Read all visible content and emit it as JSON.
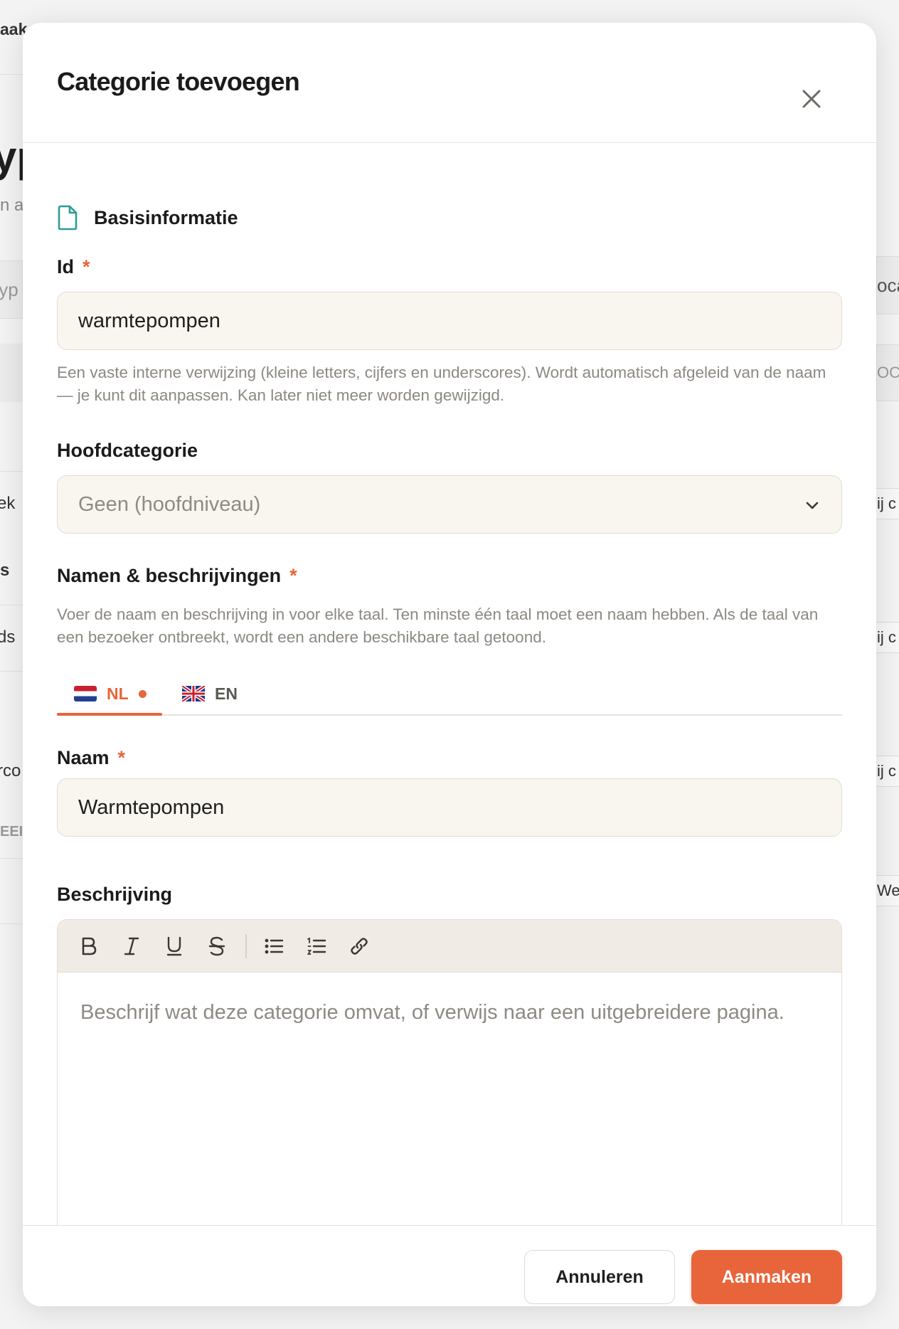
{
  "background": {
    "fragments": [
      "aak",
      "yp",
      "n a",
      "typ",
      "ek",
      "s",
      "ds",
      "rco",
      "EEI",
      "oca",
      "OCA",
      "ij c",
      "ij c",
      "ij c",
      "Wer"
    ]
  },
  "modal": {
    "title": "Categorie toevoegen",
    "section_title": "Basisinformatie",
    "id_field": {
      "label": "Id",
      "required_mark": "*",
      "value": "warmtepompen",
      "hint": "Een vaste interne verwijzing (kleine letters, cijfers en underscores). Wordt automatisch afgeleid van de naam — je kunt dit aanpassen. Kan later niet meer worden gewijzigd."
    },
    "parent_field": {
      "label": "Hoofdcategorie",
      "selected": "Geen (hoofdniveau)"
    },
    "names_section": {
      "label": "Namen & beschrijvingen",
      "required_mark": "*",
      "hint": "Voer de naam en beschrijving in voor elke taal. Ten minste één taal moet een naam hebben. Als de taal van een bezoeker ontbreekt, wordt een andere beschikbare taal getoond."
    },
    "tabs": [
      {
        "label": "NL",
        "active": true
      },
      {
        "label": "EN",
        "active": false
      }
    ],
    "name_field": {
      "label": "Naam",
      "required_mark": "*",
      "value": "Warmtepompen"
    },
    "description_field": {
      "label": "Beschrijving",
      "placeholder": "Beschrijf wat deze categorie omvat, of verwijs naar een uitgebreidere pagina."
    },
    "footer": {
      "cancel_label": "Annuleren",
      "create_label": "Aanmaken"
    }
  },
  "colors": {
    "accent": "#e8643a",
    "field_bg": "#f9f5ef",
    "icon_teal": "#2e9c94"
  }
}
